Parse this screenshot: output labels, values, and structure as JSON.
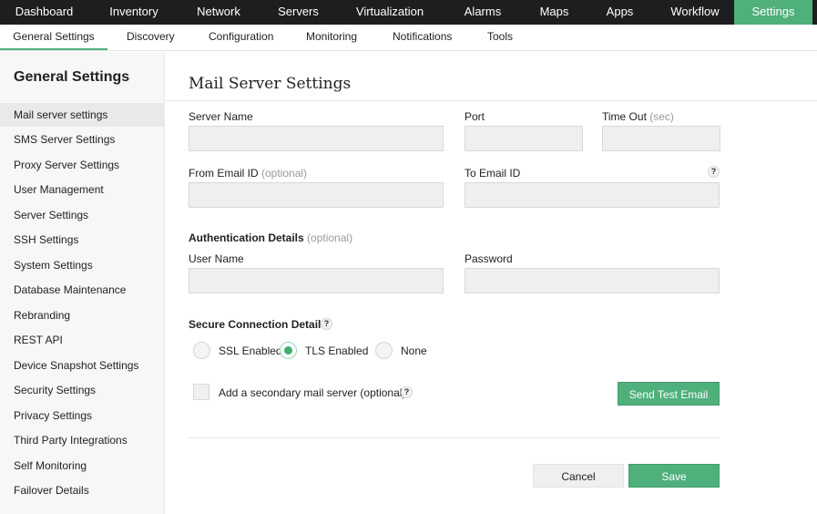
{
  "top_nav": [
    {
      "label": "Dashboard",
      "active": false
    },
    {
      "label": "Inventory",
      "active": false
    },
    {
      "label": "Network",
      "active": false
    },
    {
      "label": "Servers",
      "active": false
    },
    {
      "label": "Virtualization",
      "active": false
    },
    {
      "label": "Alarms",
      "active": false
    },
    {
      "label": "Maps",
      "active": false
    },
    {
      "label": "Apps",
      "active": false
    },
    {
      "label": "Workflow",
      "active": false
    },
    {
      "label": "Settings",
      "active": true
    }
  ],
  "sub_nav": [
    {
      "label": "General Settings",
      "active": true
    },
    {
      "label": "Discovery",
      "active": false
    },
    {
      "label": "Configuration",
      "active": false
    },
    {
      "label": "Monitoring",
      "active": false
    },
    {
      "label": "Notifications",
      "active": false
    },
    {
      "label": "Tools",
      "active": false
    }
  ],
  "sidebar": {
    "title": "General Settings",
    "items": [
      {
        "label": "Mail server settings",
        "active": true
      },
      {
        "label": "SMS Server Settings"
      },
      {
        "label": "Proxy Server Settings"
      },
      {
        "label": "User Management"
      },
      {
        "label": "Server Settings"
      },
      {
        "label": "SSH Settings"
      },
      {
        "label": "System Settings"
      },
      {
        "label": "Database Maintenance"
      },
      {
        "label": "Rebranding"
      },
      {
        "label": "REST API"
      },
      {
        "label": "Device Snapshot Settings"
      },
      {
        "label": "Security Settings"
      },
      {
        "label": "Privacy Settings"
      },
      {
        "label": "Third Party Integrations"
      },
      {
        "label": "Self Monitoring"
      },
      {
        "label": "Failover Details"
      }
    ]
  },
  "main": {
    "title": "Mail Server Settings",
    "server_name": {
      "label": "Server Name",
      "value": ""
    },
    "port": {
      "label": "Port",
      "value": ""
    },
    "timeout": {
      "label": "Time Out",
      "hint": "(sec)",
      "value": ""
    },
    "from_email": {
      "label": "From Email ID",
      "hint": "(optional)",
      "value": ""
    },
    "to_email": {
      "label": "To Email ID",
      "help_icon": "?",
      "value": ""
    },
    "auth": {
      "label": "Authentication Details",
      "hint": "(optional)"
    },
    "user_name": {
      "label": "User Name",
      "value": ""
    },
    "password": {
      "label": "Password",
      "value": ""
    },
    "secure": {
      "label": "Secure Connection Details",
      "help_icon": "?",
      "options": [
        {
          "label": "SSL Enabled",
          "checked": false
        },
        {
          "label": "TLS Enabled",
          "checked": true
        },
        {
          "label": "None",
          "checked": false
        }
      ]
    },
    "secondary": {
      "label": "Add a secondary mail server (optional)",
      "checked": false,
      "help_icon": "?"
    },
    "send_test_label": "Send Test Email",
    "cancel_label": "Cancel",
    "save_label": "Save"
  },
  "colors": {
    "accent": "#4fb07c",
    "topbar": "#1e1e1e",
    "radio_checked": "#3fae6d"
  }
}
